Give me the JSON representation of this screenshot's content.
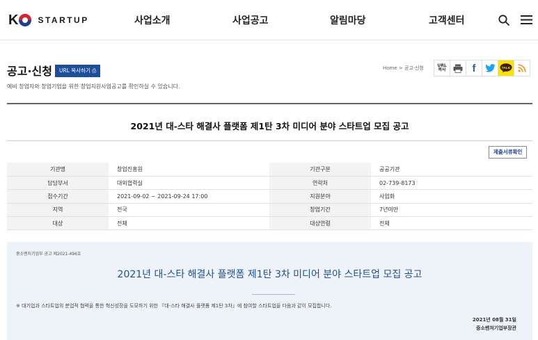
{
  "header": {
    "logo_mark": "K",
    "logo_text": "STARTUP",
    "nav": [
      "사업소개",
      "사업공고",
      "알림마당",
      "고객센터"
    ]
  },
  "page": {
    "title": "공고·신청",
    "url_copy_label": "URL 복사하기 ⎙",
    "description": "예비 창업자와 창업기업을 위한 창업지원사업공고를 확인하실 수 있습니다.",
    "breadcrumb": "Home > 공고·신청",
    "share": {
      "url_label_1": "URL",
      "url_label_2": "복사",
      "facebook_label": "f",
      "kakao_label": "TALK"
    }
  },
  "notice": {
    "title": "2021년 대-스타 해결사 플랫폼 제1탄 3차 미디어 분야 스타트업 모집 공고",
    "docs_button": "제출서류확인",
    "rows": [
      {
        "k1": "기관명",
        "v1": "창업진흥원",
        "k2": "기관구분",
        "v2": "공공기관"
      },
      {
        "k1": "담당부서",
        "v1": "대외협력실",
        "k2": "연락처",
        "v2": "02-739-8173"
      },
      {
        "k1": "접수기간",
        "v1": "2021-09-02 ~ 2021-09-24 17:00",
        "k2": "지원분야",
        "v2": "사업화"
      },
      {
        "k1": "지역",
        "v1": "전국",
        "k2": "창업기간",
        "v2": "7년미만"
      },
      {
        "k1": "대상",
        "v1": "전체",
        "k2": "대상연령",
        "v2": "전체"
      }
    ]
  },
  "content": {
    "doc_number": "중소벤처기업부 공고 제2021-496호",
    "title": "2021년 대-스타 해결사 플랫폼 제1탄 3차 미디어 분야 스타트업 모집 공고",
    "body": "※ 대기업과 스타트업의 분업적 협력을 통한 혁신성장을 도모하기 위한 『대-스타 해결사 플랫폼 제1탄 3차』에 참여할 스타트업을 다음과 같이 모집합니다.",
    "date": "2021년 08월 31일",
    "issuer": "중소벤처기업부장관"
  },
  "colors": {
    "brand_blue": "#1e4f9c",
    "brand_red": "#d8242f",
    "kakao_yellow": "#fbe300",
    "facebook_blue": "#3b5998",
    "twitter_blue": "#1da1f2",
    "rss_orange": "#f7931e",
    "panel_bg": "#eef3f9"
  },
  "icons": [
    "search-icon",
    "menu-icon",
    "print-icon",
    "facebook-icon",
    "twitter-icon",
    "kakao-talk-icon",
    "rss-icon",
    "copy-icon"
  ]
}
